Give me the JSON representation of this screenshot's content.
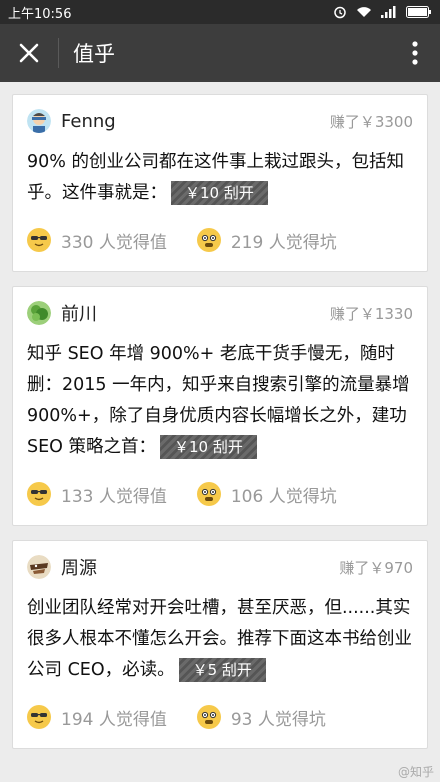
{
  "status_bar": {
    "time": "上午10:56"
  },
  "app_bar": {
    "title": "值乎"
  },
  "cards": [
    {
      "author": "Fenng",
      "earned": "赚了￥3300",
      "text": "90% 的创业公司都在这件事上栽过跟头，包括知乎。这件事就是：",
      "reveal": "￥10 刮开",
      "worth": "330 人觉得值",
      "pit": "219 人觉得坑"
    },
    {
      "author": "前川",
      "earned": "赚了￥1330",
      "text": "知乎 SEO 年增 900%+ 老底干货手慢无，随时删：2015 一年内，知乎来自搜索引擎的流量暴增 900%+，除了自身优质内容长幅增长之外，建功 SEO 策略之首：",
      "reveal": "￥10 刮开",
      "worth": "133 人觉得值",
      "pit": "106 人觉得坑"
    },
    {
      "author": "周源",
      "earned": "赚了￥970",
      "text": "创业团队经常对开会吐槽，甚至厌恶，但......其实很多人根本不懂怎么开会。推荐下面这本书给创业公司 CEO，必读。",
      "reveal": "￥5 刮开",
      "worth": "194 人觉得值",
      "pit": "93 人觉得坑"
    }
  ],
  "watermark": "@知乎",
  "colors": {
    "status_bar": "#2b2b2b",
    "app_bar": "#3d3d3d",
    "background": "#ececec",
    "emoji_yellow": "#f6c94a"
  }
}
